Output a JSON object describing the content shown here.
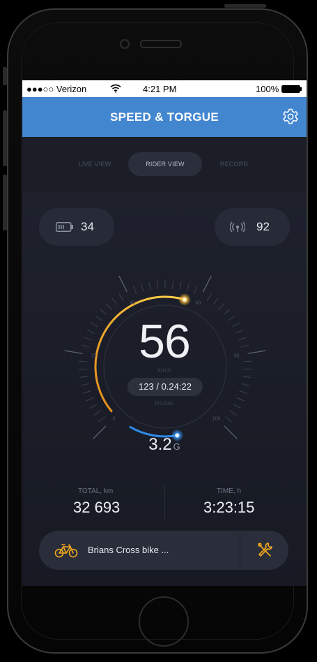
{
  "status_bar": {
    "carrier": "●●●○○ Verizon",
    "time": "4:21 PM",
    "battery": "100%"
  },
  "header": {
    "title": "SPEED & TORGUE",
    "settings_icon": "gear-icon"
  },
  "tabs": [
    {
      "label": "LIVE VIEW",
      "active": false
    },
    {
      "label": "RIDER VIEW",
      "active": true
    },
    {
      "label": "RECORD",
      "active": false
    }
  ],
  "battery_pill": {
    "icon": "battery-icon",
    "value": "34"
  },
  "signal_pill": {
    "icon": "signal-icon",
    "value": "92"
  },
  "gauge": {
    "speed": "56",
    "speed_unit": "km/h",
    "distance_time": "123 / 0.24:22",
    "distance_unit": "km/sec",
    "g_value": "3.2",
    "g_unit": "G",
    "tick_labels": [
      "0",
      "20",
      "40",
      "60",
      "80",
      "100"
    ],
    "speed_level": 0.56,
    "accel_level": 0.32
  },
  "stats": {
    "total_label": "TOTAL, km",
    "total_value": "32 693",
    "time_label": "TIME, h",
    "time_value": "3:23:15"
  },
  "bike": {
    "name": "Brians Cross bike ...",
    "bike_icon": "bicycle-icon",
    "tools_icon": "wrench-screwdriver-icon"
  },
  "colors": {
    "header_blue": "#4386d0",
    "accent_orange": "#f2a81d",
    "accent_blue": "#2f8ae8",
    "background": "#1c1f2a"
  }
}
